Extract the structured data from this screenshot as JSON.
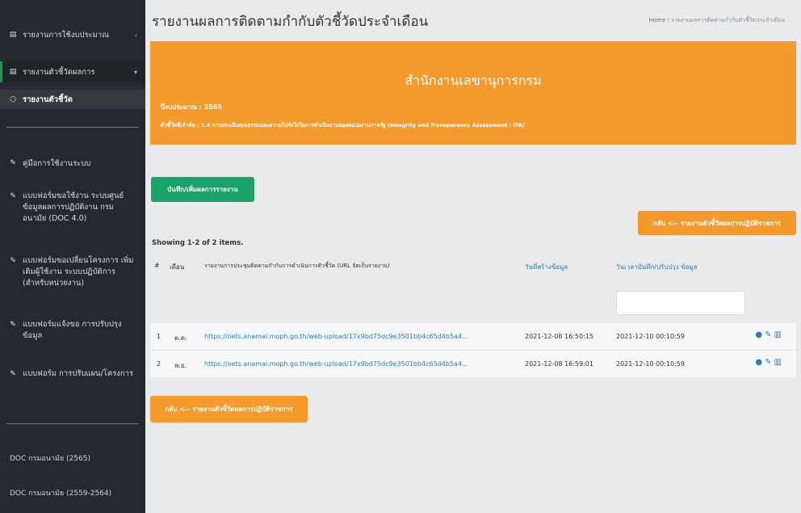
{
  "sidebar": {
    "items": [
      {
        "label": "รายงานการใช้งบประมาณ"
      },
      {
        "label": "รายงานตัวชี้วัดผลการ"
      },
      {
        "label": "รายงานตัวชี้วัด"
      },
      {
        "label": "คู่มือการใช้งานระบบ"
      },
      {
        "label": "แบบฟอร์มขอใช้งาน ระบบศูนย์ข้อมูลผลการปฏิบัติงาน กรมอนามัย (DOC 4.0)"
      },
      {
        "label": "แบบฟอร์มขอเปลี่ยนโครงการ เพิ่มเติมผู้ใช้งาน ระบบปฏิบัติการ (สำหรับหน่วยงาน)"
      },
      {
        "label": "แบบฟอร์มแจ้งขอ การปรับปรุงข้อมูล"
      },
      {
        "label": "แบบฟอร์ม การปรับแผน/โครงการ"
      }
    ],
    "bottom_links": [
      "DOC กรมอนามัย (2565)",
      "DOC กรมอนามัย (2559-2564)"
    ]
  },
  "header": {
    "title": "รายงานผลการติดตามกำกับตัวชี้วัดประจำเดือน",
    "breadcrumb_home": "Home",
    "breadcrumb_current": "รายงานผลการติดตามกำกับตัวชี้วัดประจำเดือน"
  },
  "info_box": {
    "title": "สำนักงานเลขานุการกรม",
    "fiscal_year": "ปีงบประมาณ : 2565",
    "indicator": "ตัวชี้วัดที่/ลำดับ : 1.4 การประเมินคุณธรรมและความโปร่งใสในการดำเนินงานของหน่วยงานภาครัฐ (Integrity and Transparency Assessment : ITA)"
  },
  "buttons": {
    "add_report": "บันทึก/เพิ่มผลการรายงาน",
    "back_top": "กลับ <-- รายงานตัวชี้วัดผลการปฏิบัติราชการ",
    "back_bottom": "กลับ <-- รายงานตัวชี้วัดผลการปฏิบัติราชการ"
  },
  "table": {
    "summary": "Showing 1-2 of 2 items.",
    "headers": [
      "#",
      "เดือน",
      "รายงานการประชุมติดตามกำกับการดำเนินการตัวชี้วัด (URL จัดเก็บรายงาน)",
      "วันที่สร้างข้อมูล",
      "วันเวลาบันทึก/ปรับปรุง ข้อมูล"
    ],
    "rows": [
      {
        "num": "1",
        "month": "ต.ค.",
        "url": "https://oets.anamai.moph.go.th/web-upload/17x9bd75dc9e3501bb4c65d4b5a4...",
        "created": "2021-12-08 16:50:15",
        "updated": "2021-12-10 00:10:59"
      },
      {
        "num": "2",
        "month": "พ.ย.",
        "url": "https://oets.anamai.moph.go.th/web-upload/17x9bd75dc9e3501bb4c65d4b5a4...",
        "created": "2021-12-08 16:59:01",
        "updated": "2021-12-10 00:10:59"
      }
    ]
  },
  "colors": {
    "sidebar_bg": "#23292f",
    "orange": "#f39c2d",
    "green": "#1aa368",
    "link": "#2d7bb8"
  }
}
